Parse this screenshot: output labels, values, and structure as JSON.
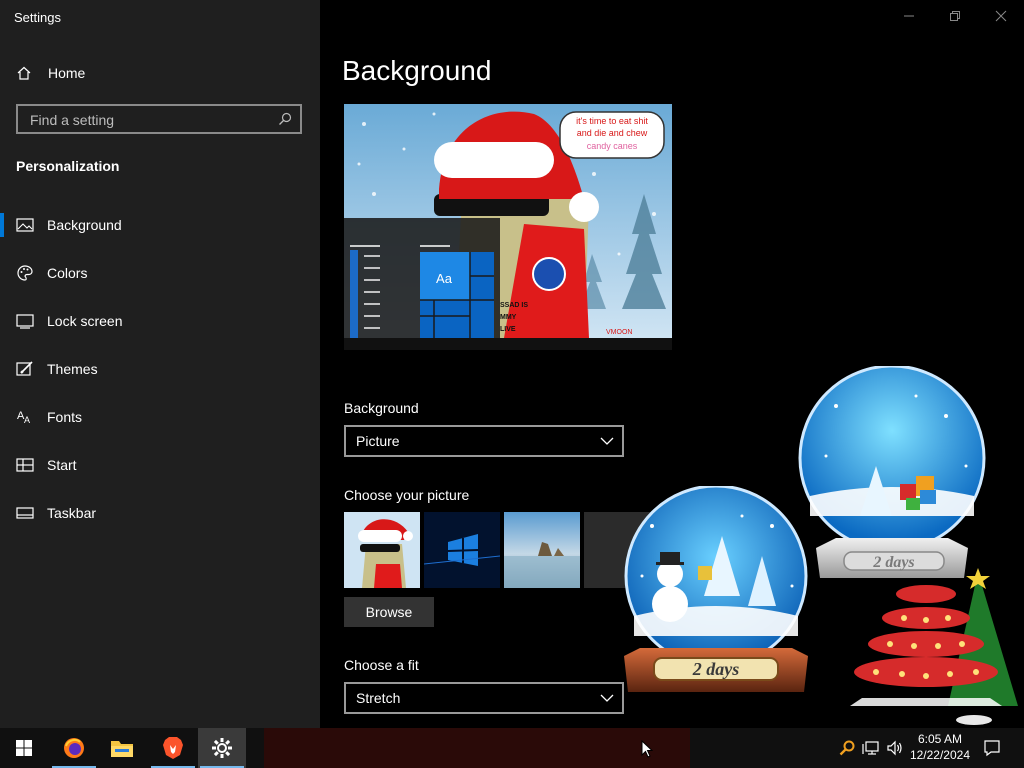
{
  "window": {
    "title": "Settings"
  },
  "sidebar": {
    "home_label": "Home",
    "search_placeholder": "Find a setting",
    "section_label": "Personalization",
    "items": [
      {
        "label": "Background",
        "icon": "picture-icon",
        "active": true
      },
      {
        "label": "Colors",
        "icon": "palette-icon"
      },
      {
        "label": "Lock screen",
        "icon": "lock-screen-icon"
      },
      {
        "label": "Themes",
        "icon": "brush-icon"
      },
      {
        "label": "Fonts",
        "icon": "font-icon"
      },
      {
        "label": "Start",
        "icon": "start-icon"
      },
      {
        "label": "Taskbar",
        "icon": "taskbar-icon"
      }
    ]
  },
  "main": {
    "page_title": "Background",
    "preview": {
      "speech_text": [
        "it's time to eat shit",
        "and die and chew",
        "candy canes"
      ],
      "tile_label": "Aa",
      "shirt_text": [
        "SSAD IS",
        "MMY",
        "LIVE"
      ],
      "signature": "VMOON"
    },
    "background_label": "Background",
    "background_value": "Picture",
    "choose_picture_label": "Choose your picture",
    "browse_label": "Browse",
    "choose_fit_label": "Choose a fit",
    "fit_value": "Stretch"
  },
  "overlay": {
    "globe_small_text": "2 days",
    "globe_large_text": "2 days"
  },
  "taskbar": {
    "time": "6:05 AM",
    "date": "12/22/2024"
  },
  "colors": {
    "accent": "#0078d7",
    "sidebar_bg": "#1f1f1f",
    "main_bg": "#000000",
    "taskbar_bg": "#101010"
  }
}
